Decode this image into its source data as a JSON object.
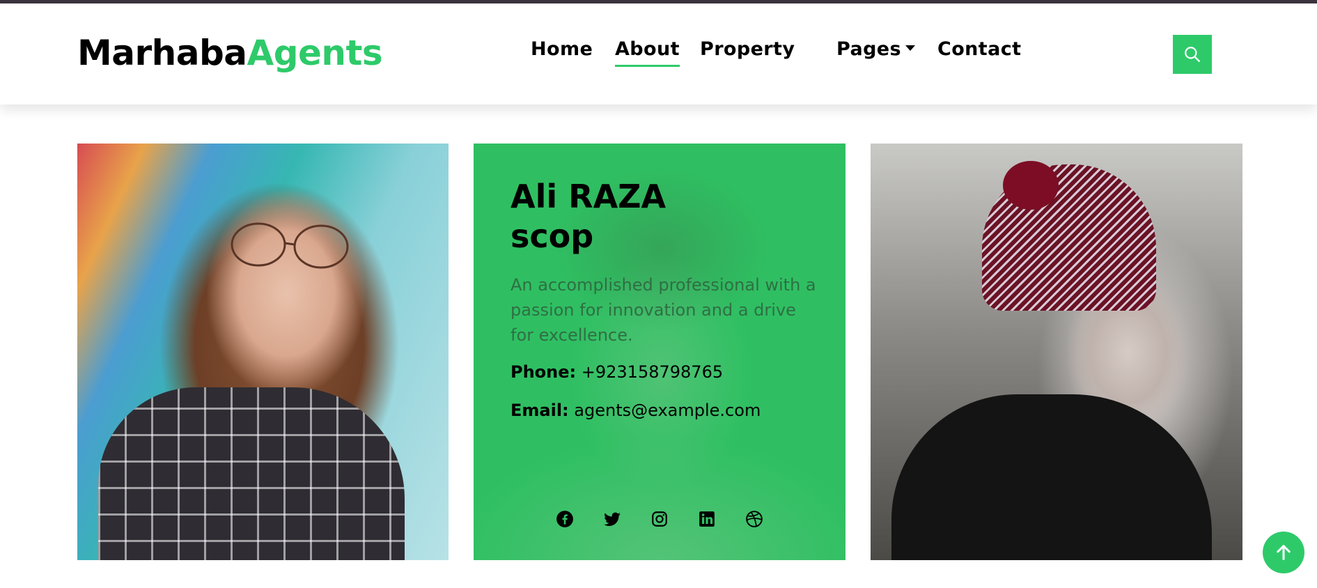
{
  "brand": {
    "part1": "Marhaba",
    "part2": "Agents"
  },
  "nav": {
    "items": [
      {
        "label": "Home",
        "active": false
      },
      {
        "label": "About",
        "active": true
      },
      {
        "label": "Property",
        "active": false
      },
      {
        "label": "Pages",
        "active": false,
        "has_dropdown": true
      },
      {
        "label": "Contact",
        "active": false
      }
    ]
  },
  "search": {
    "icon": "search-icon"
  },
  "agent": {
    "name_line1": "Ali RAZA",
    "name_line2": "scop",
    "description": "An accomplished professional with a passion for innovation and a drive for excellence.",
    "phone_label": "Phone:",
    "phone": "+923158798765",
    "email_label": "Email:",
    "email": "agents@example.com",
    "socials": [
      "facebook-icon",
      "twitter-icon",
      "instagram-icon",
      "linkedin-icon",
      "dribbble-icon"
    ]
  },
  "colors": {
    "accent": "#2eca6a",
    "card_green": "#2fbf62",
    "topbar": "#3c3540"
  },
  "back_to_top": {
    "icon": "arrow-up-icon"
  }
}
